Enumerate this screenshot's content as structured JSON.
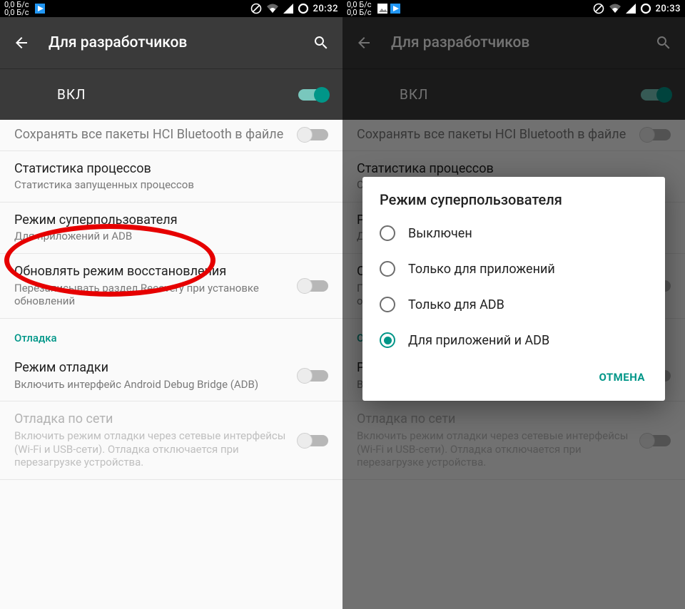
{
  "left": {
    "status": {
      "net": "0,0 Б/с\n0,0 Б/с",
      "time": "20:32"
    },
    "header": {
      "title": "Для разработчиков"
    },
    "master": {
      "label": "ВКЛ"
    },
    "items": {
      "hci": {
        "primary": "Сохранять все пакеты HCI Bluetooth в файле",
        "secondary": ""
      },
      "stat": {
        "primary": "Статистика процессов",
        "secondary": "Статистика запущенных процессов"
      },
      "root": {
        "primary": "Режим суперпользователя",
        "secondary": "Для приложений и ADB"
      },
      "rec": {
        "primary": "Обновлять режим восстановления",
        "secondary": "Перезаписывать раздел Recovery при установке обновлений"
      },
      "adb": {
        "primary": "Режим отладки",
        "secondary": "Включить интерфейс Android Debug Bridge (ADB)"
      },
      "netdbg": {
        "primary": "Отладка по сети",
        "secondary": "Включить режим отладки через сетевые интерфейсы (Wi-Fi и USB-сети). Отладка отключается при перезагрузке устройства."
      }
    },
    "section_debug": "Отладка"
  },
  "right": {
    "status": {
      "net": "0,0 Б/с\n0,0 Б/с",
      "time": "20:33"
    },
    "header": {
      "title": "Для разработчиков"
    },
    "master": {
      "label": "ВКЛ"
    },
    "dialog": {
      "title": "Режим суперпользователя",
      "options": [
        {
          "label": "Выключен"
        },
        {
          "label": "Только для приложений"
        },
        {
          "label": "Только для ADB"
        },
        {
          "label": "Для приложений и ADB"
        }
      ],
      "selected": 3,
      "cancel": "ОТМЕНА"
    }
  }
}
